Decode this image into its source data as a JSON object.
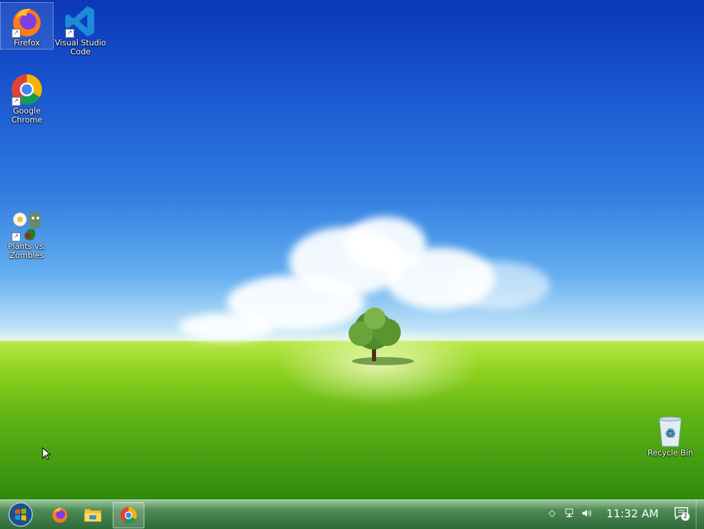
{
  "desktop": {
    "icons": [
      {
        "label": "Firefox"
      },
      {
        "label": "Visual Studio Code"
      },
      {
        "label": "Google Chrome"
      },
      {
        "label": "Plants vs. Zombies"
      },
      {
        "label": "Recycle Bin"
      }
    ]
  },
  "taskbar": {
    "start_icon": "windows-start-orb",
    "pinned": [
      "firefox-icon",
      "file-explorer-icon",
      "chrome-icon"
    ],
    "active_app": "Google Chrome"
  },
  "tray": {
    "clock": "11:32 AM",
    "notification_count": "2",
    "icons": [
      "network-icon",
      "volume-icon",
      "show-hidden-icon"
    ]
  },
  "colors": {
    "sky_top": "#0a38b8",
    "grass": "#5db315",
    "taskbar": "#3e7a48"
  }
}
